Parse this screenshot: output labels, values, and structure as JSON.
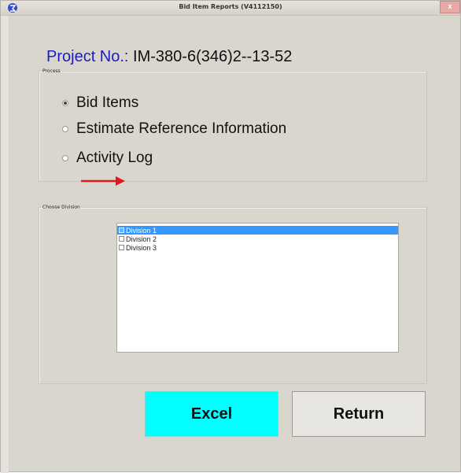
{
  "window": {
    "title": "Bid Item Reports (V4112150)",
    "close_glyph": "x",
    "app_icon": "app-logo-icon"
  },
  "project": {
    "label": "Project No.:",
    "value": "IM-380-6(346)2--13-52"
  },
  "process": {
    "legend": "Process",
    "options": [
      {
        "label": "Bid Items",
        "selected": true
      },
      {
        "label": "Estimate Reference Information",
        "selected": false
      },
      {
        "label": "Activity Log",
        "selected": false
      }
    ]
  },
  "annotation": {
    "arrow_color": "#e8141e",
    "arrow_icon": "right-arrow-icon"
  },
  "division": {
    "legend": "Choose Division",
    "items": [
      {
        "label": "Division 1",
        "selected": true,
        "checked": false
      },
      {
        "label": "Division 2",
        "selected": false,
        "checked": false
      },
      {
        "label": "Division 3",
        "selected": false,
        "checked": false
      }
    ]
  },
  "buttons": {
    "excel": "Excel",
    "return": "Return"
  },
  "colors": {
    "excel_button": "#00ffff",
    "selection": "#3399ff",
    "project_label": "#1c1cc6"
  }
}
